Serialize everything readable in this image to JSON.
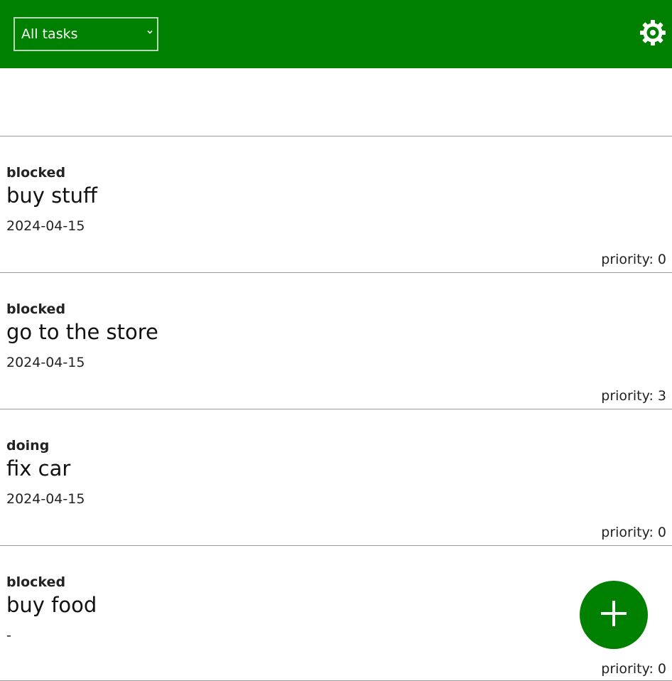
{
  "header": {
    "filter": {
      "selected": "All tasks"
    },
    "settings_icon": "gear-icon",
    "accent_color": "#008000"
  },
  "tasks": [
    {
      "status": "blocked",
      "title": "buy stuff",
      "date": "2024-04-15",
      "priority": "priority: 0"
    },
    {
      "status": "blocked",
      "title": "go to the store",
      "date": "2024-04-15",
      "priority": "priority: 3"
    },
    {
      "status": "doing",
      "title": "fix car",
      "date": "2024-04-15",
      "priority": "priority: 0"
    },
    {
      "status": "blocked",
      "title": "buy food",
      "date": "-",
      "priority": "priority: 0"
    }
  ],
  "fab": {
    "icon": "plus-icon"
  }
}
